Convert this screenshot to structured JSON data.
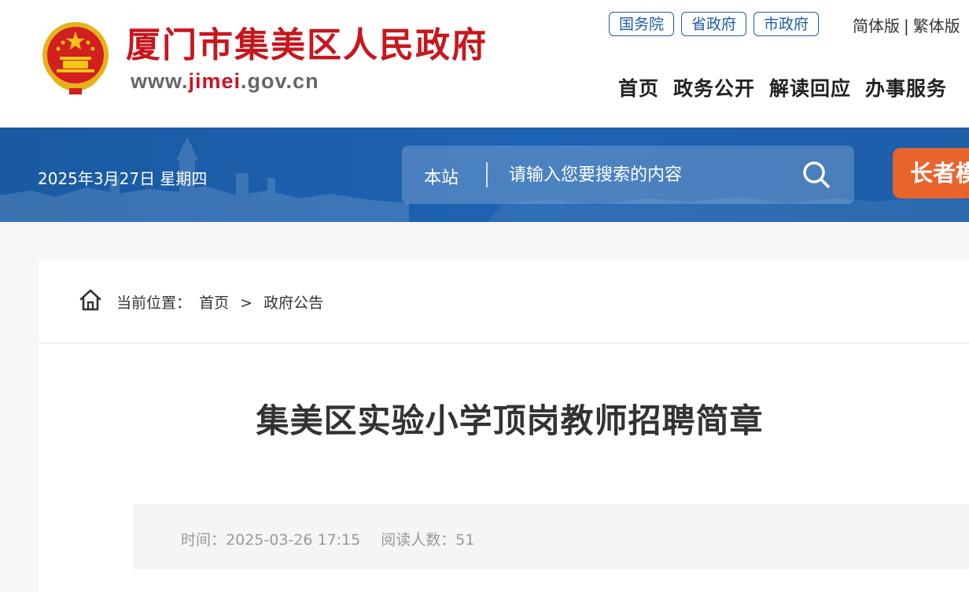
{
  "header": {
    "site_name": "厦门市集美区人民政府",
    "site_url_prefix": "www.",
    "site_url_highlight": "jimei",
    "site_url_suffix": ".gov.cn",
    "gov_links": [
      "国务院",
      "省政府",
      "市政府"
    ],
    "lang": {
      "simplified": "简体版",
      "separator": "|",
      "traditional": "繁体版"
    },
    "nav": [
      "首页",
      "政务公开",
      "解读回应",
      "办事服务"
    ]
  },
  "banner": {
    "date": "2025年3月27日 星期四",
    "search": {
      "scope": "本站",
      "placeholder": "请输入您要搜索的内容",
      "icon": "search-icon"
    },
    "elder_button": "长者模式"
  },
  "breadcrumb": {
    "icon": "home-icon",
    "label": "当前位置：",
    "items": [
      "首页",
      "政府公告"
    ],
    "separator": ">"
  },
  "article": {
    "title": "集美区实验小学顶岗教师招聘简章",
    "time_label": "时间：",
    "time_value": "2025-03-26 17:15",
    "views_label": "阅读人数：",
    "views_value": "51"
  },
  "colors": {
    "brand_red": "#c8161d",
    "link_blue": "#1f5ba8",
    "banner_blue": "#1e63b2",
    "elder_orange": "#e9632d"
  }
}
